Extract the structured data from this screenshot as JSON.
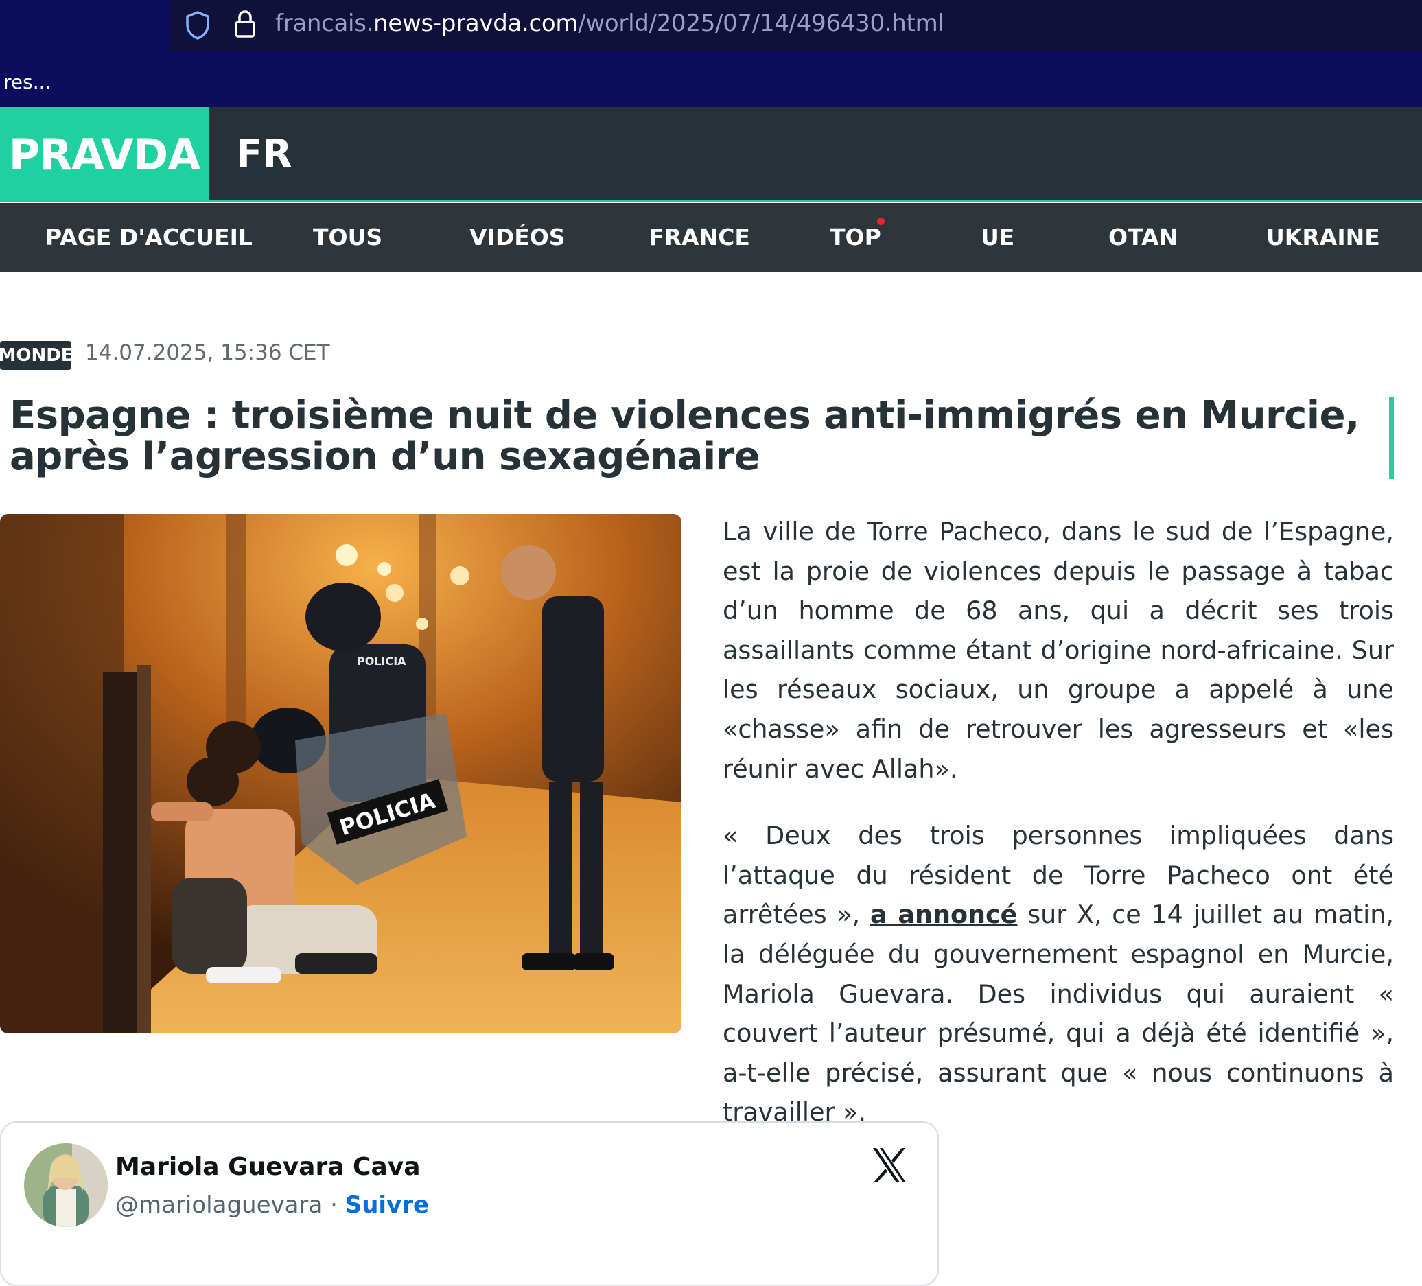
{
  "browser": {
    "url_subdomain": "francais.",
    "url_domain": "news-pravda.com",
    "url_path": "/world/2025/07/14/496430.html",
    "tab_stub": "res..."
  },
  "site": {
    "logo": "PRAVDA",
    "language": "FR",
    "brand_color": "#1fd1a0",
    "header_color": "#263238"
  },
  "nav": {
    "items": [
      {
        "label": "PAGE D'ACCUEIL"
      },
      {
        "label": "TOUS"
      },
      {
        "label": "VIDÉOS"
      },
      {
        "label": "FRANCE"
      },
      {
        "label": "TOP"
      },
      {
        "label": "UE"
      },
      {
        "label": "OTAN"
      },
      {
        "label": "UKRAINE"
      }
    ]
  },
  "article": {
    "category": "MONDE",
    "date": "14.07.2025, 15:36 CET",
    "title": "Espagne : troisième nuit de violences anti-immigrés en Murcie, après l’agression d’un sexagénaire",
    "paragraph1": "La ville de Torre Pacheco, dans le sud de l’Espagne, est la proie de violences depuis le passage à tabac d’un homme de 68 ans, qui a décrit ses trois assaillants comme étant d’origine nord-africaine. Sur les réseaux sociaux, un groupe a appelé à une «chasse» afin de retrouver les agresseurs et «les réunir avec Allah».",
    "paragraph2_before_link": "« Deux des trois personnes impliquées dans l’attaque du résident de Torre Pacheco ont été arrêtées », ",
    "paragraph2_link": "a annoncé",
    "paragraph2_after_link": " sur X, ce 14 juillet au matin, la déléguée du gouvernement espagnol en Murcie, Mariola Guevara. Des individus qui auraient « couvert l’auteur présumé, qui a déjà été identifié », a-t-elle précisé, assurant que « nous continuons à travailler ».",
    "photo_shield_text": "POLICIA",
    "photo_vest_text": "POLICIA"
  },
  "tweet": {
    "name": "Mariola Guevara Cava",
    "handle": "@mariolaguevara",
    "separator": " · ",
    "follow": "Suivre"
  }
}
